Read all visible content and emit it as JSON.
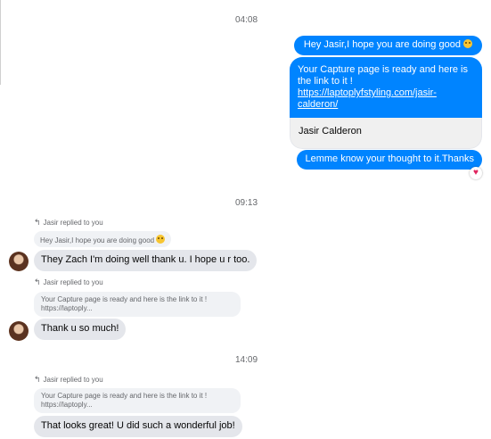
{
  "timestamps": [
    "04:08",
    "09:13",
    "14:09"
  ],
  "outgoing": {
    "msg1": "Hey Jasir,I hope you are doing good",
    "link_card": {
      "text": "Your Capture page is ready and here is the link to it !",
      "link": "https://laptoplyfstyling.com/jasir-calderon/",
      "link_line1": "https://laptoplyfstyling.com/jasir-",
      "link_line2": "calderon/",
      "title": "Jasir Calderon"
    },
    "msg3": "Lemme know your thought to it.Thanks",
    "reaction_icon": "heart-icon"
  },
  "replies": [
    {
      "label": "Jasir replied to you",
      "quote": "Hey Jasir,I hope you are doing good",
      "message": "They Zach I'm doing well thank u. I hope u r too."
    },
    {
      "label": "Jasir replied to you",
      "quote_line1": "Your Capture page is ready and here is the link to it !",
      "quote_line2": "https://laptoply...",
      "message": "Thank u so much!"
    },
    {
      "label": "Jasir replied to you",
      "quote_line1": "Your Capture page is ready and here is the link to it !",
      "quote_line2": "https://laptoply...",
      "message": "That looks great! U did such a wonderful job!"
    }
  ],
  "colors": {
    "outgoing_bubble": "#0084ff",
    "incoming_bubble": "#e4e6eb",
    "quote_bubble": "#f0f2f5",
    "reaction": "#e0245e"
  }
}
